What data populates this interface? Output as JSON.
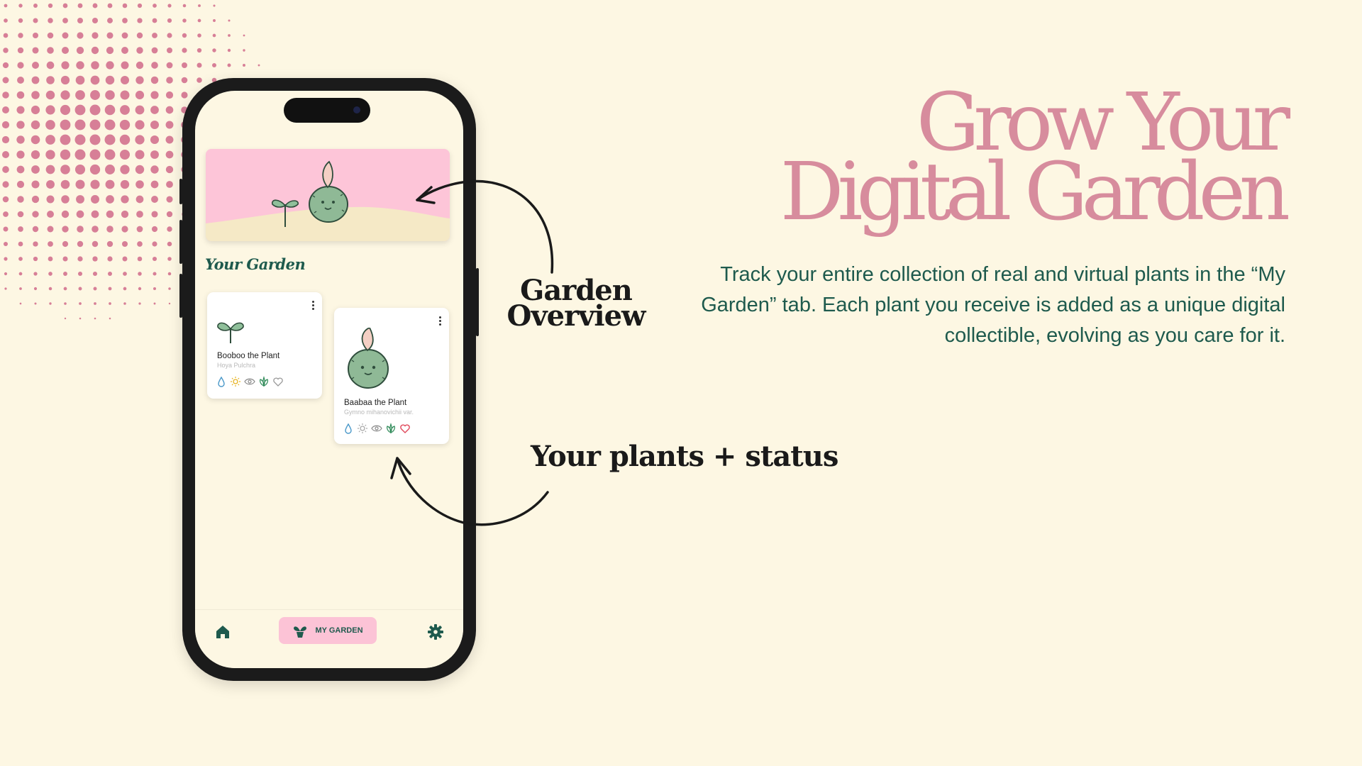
{
  "hero": {
    "title_line1": "Grow Your",
    "title_line2": "Digital Garden",
    "description": "Track your entire collection of real and virtual plants in the “My Garden” tab. Each plant you receive is added as a unique digital collectible, evolving as you care for it."
  },
  "callouts": {
    "overview_line1": "Garden",
    "overview_line2": "Overview",
    "plants_status": "Your plants + status"
  },
  "app": {
    "section_title": "Your Garden",
    "plants": [
      {
        "name": "Booboo the Plant",
        "species": "Hoya Pulchra",
        "icon": "sprout-icon",
        "status_icons": [
          "water-icon",
          "sun-icon",
          "eye-icon",
          "leaf-icon",
          "heart-outline-icon"
        ]
      },
      {
        "name": "Baabaa the Plant",
        "species": "Gymno mihanovichii var.",
        "icon": "cactus-icon",
        "status_icons": [
          "water-icon",
          "sun-icon",
          "eye-icon",
          "leaf-icon",
          "heart-icon"
        ]
      }
    ],
    "tabs": {
      "home_icon": "home-icon",
      "garden_label": "MY GARDEN",
      "settings_icon": "gear-icon"
    }
  },
  "colors": {
    "background": "#fdf7e3",
    "accent_pink": "#d78c9d",
    "brand_green": "#1e5a4d",
    "banner_pink": "#fdc5d8",
    "dot_pink": "#d77f97"
  }
}
